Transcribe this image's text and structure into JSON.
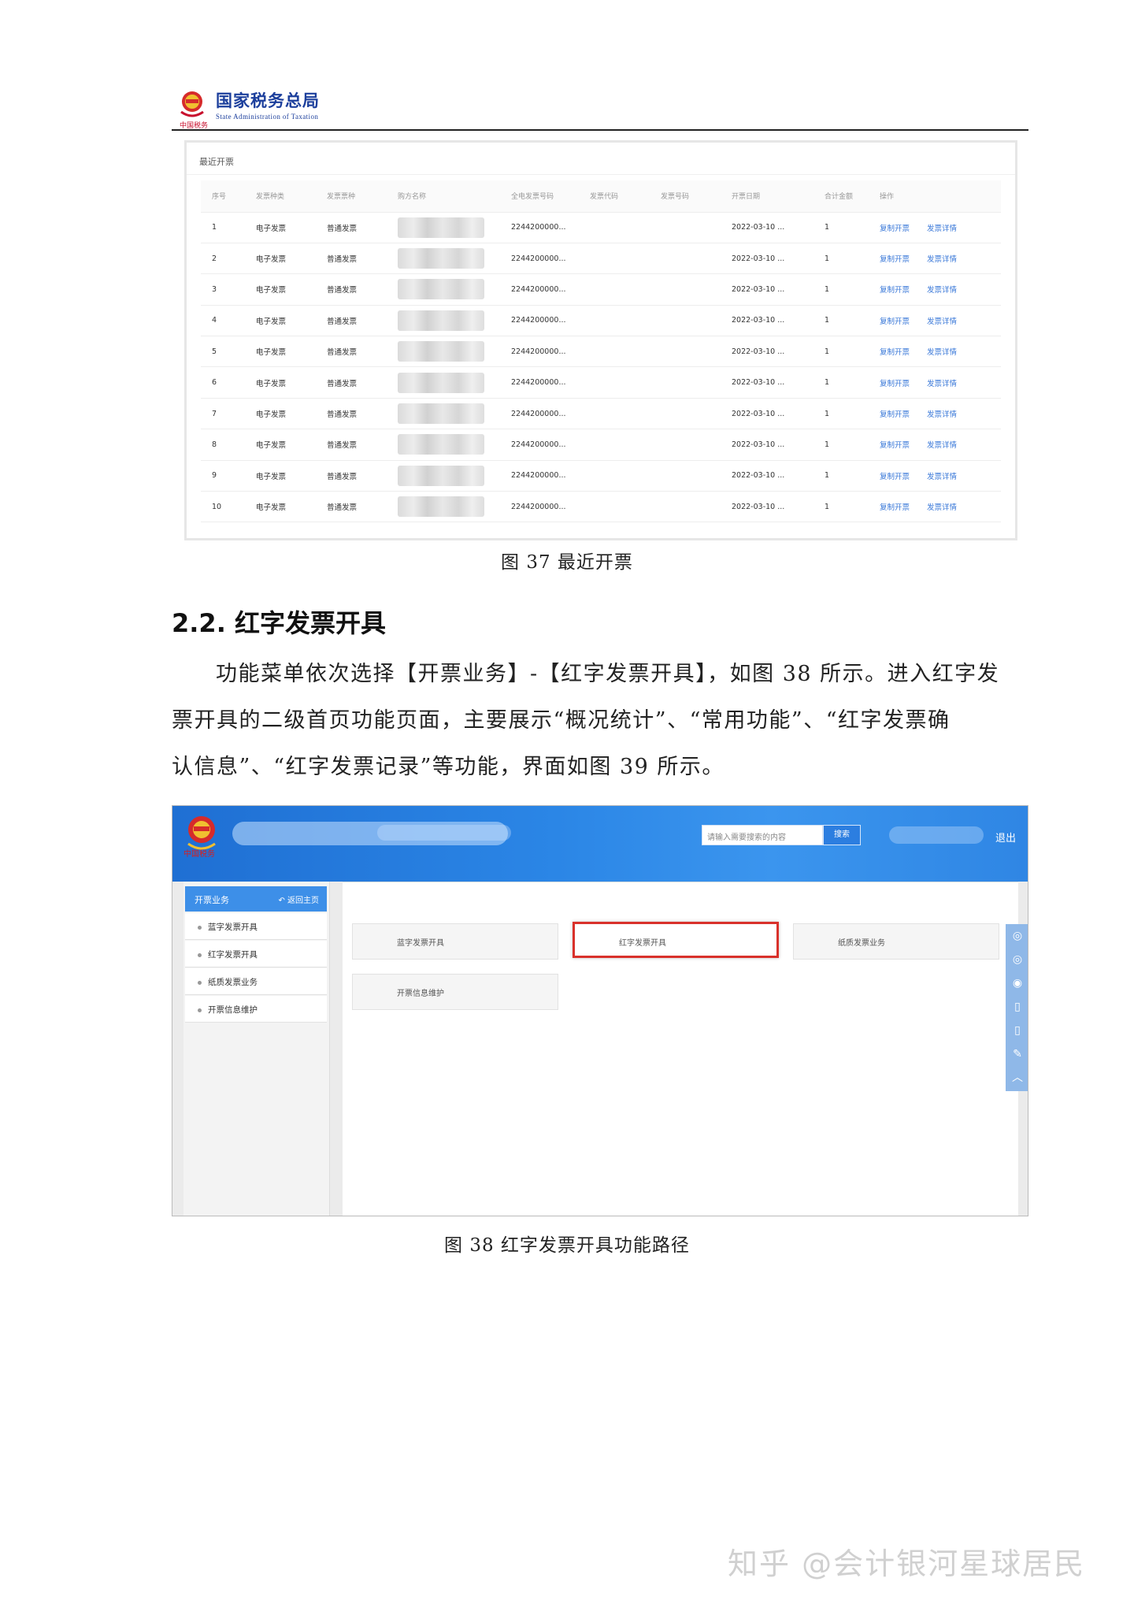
{
  "header": {
    "org_cn": "国家税务总局",
    "org_en": "State Administration of Taxation",
    "signature": "中国税务"
  },
  "fig37": {
    "card_title": "最近开票",
    "columns": [
      "序号",
      "发票种类",
      "发票票种",
      "购方名称",
      "全电发票号码",
      "发票代码",
      "发票号码",
      "开票日期",
      "合计金额",
      "操作"
    ],
    "rows": [
      {
        "no": "1",
        "kind": "电子发票",
        "type": "普通发票",
        "number": "2244200000...",
        "date": "2022-03-10 ...",
        "amount": "1",
        "op1": "复制开票",
        "op2": "发票详情"
      },
      {
        "no": "2",
        "kind": "电子发票",
        "type": "普通发票",
        "number": "2244200000...",
        "date": "2022-03-10 ...",
        "amount": "1",
        "op1": "复制开票",
        "op2": "发票详情"
      },
      {
        "no": "3",
        "kind": "电子发票",
        "type": "普通发票",
        "number": "2244200000...",
        "date": "2022-03-10 ...",
        "amount": "1",
        "op1": "复制开票",
        "op2": "发票详情"
      },
      {
        "no": "4",
        "kind": "电子发票",
        "type": "普通发票",
        "number": "2244200000...",
        "date": "2022-03-10 ...",
        "amount": "1",
        "op1": "复制开票",
        "op2": "发票详情"
      },
      {
        "no": "5",
        "kind": "电子发票",
        "type": "普通发票",
        "number": "2244200000...",
        "date": "2022-03-10 ...",
        "amount": "1",
        "op1": "复制开票",
        "op2": "发票详情"
      },
      {
        "no": "6",
        "kind": "电子发票",
        "type": "普通发票",
        "number": "2244200000...",
        "date": "2022-03-10 ...",
        "amount": "1",
        "op1": "复制开票",
        "op2": "发票详情"
      },
      {
        "no": "7",
        "kind": "电子发票",
        "type": "普通发票",
        "number": "2244200000...",
        "date": "2022-03-10 ...",
        "amount": "1",
        "op1": "复制开票",
        "op2": "发票详情"
      },
      {
        "no": "8",
        "kind": "电子发票",
        "type": "普通发票",
        "number": "2244200000...",
        "date": "2022-03-10 ...",
        "amount": "1",
        "op1": "复制开票",
        "op2": "发票详情"
      },
      {
        "no": "9",
        "kind": "电子发票",
        "type": "普通发票",
        "number": "2244200000...",
        "date": "2022-03-10 ...",
        "amount": "1",
        "op1": "复制开票",
        "op2": "发票详情"
      },
      {
        "no": "10",
        "kind": "电子发票",
        "type": "普通发票",
        "number": "2244200000...",
        "date": "2022-03-10 ...",
        "amount": "1",
        "op1": "复制开票",
        "op2": "发票详情"
      }
    ],
    "caption": "图 37 最近开票"
  },
  "section": {
    "title": "2.2. 红字发票开具",
    "para1_line1": "功能菜单依次选择【开票业务】-【红字发票开具】，如图 38 所示。进入红字发",
    "para1_line2": "票开具的二级首页功能页面，主要展示“概况统计”、“常用功能”、“红字发票确",
    "para1_line3": "认信息”、“红字发票记录”等功能，界面如图 39 所示。"
  },
  "fig38": {
    "logo_text": "中国税务",
    "search_placeholder": "请输入需要搜索的内容",
    "search_button": "搜索",
    "logout": "退出",
    "sidebar_title": "开票业务",
    "back_home": "返回主页",
    "sidebar_items": [
      "蓝字发票开具",
      "红字发票开具",
      "纸质发票业务",
      "开票信息维护"
    ],
    "tiles": [
      "蓝字发票开具",
      "红字发票开具",
      "纸质发票业务",
      "开票信息维护"
    ],
    "caption": "图 38 红字发票开具功能路径"
  },
  "watermark": "知乎 @会计银河星球居民",
  "colors": {
    "brand_blue": "#1c3f9c",
    "topbar_blue": "#2b86e6",
    "highlight_red": "#d9312b",
    "link_blue": "#3a78d8"
  }
}
